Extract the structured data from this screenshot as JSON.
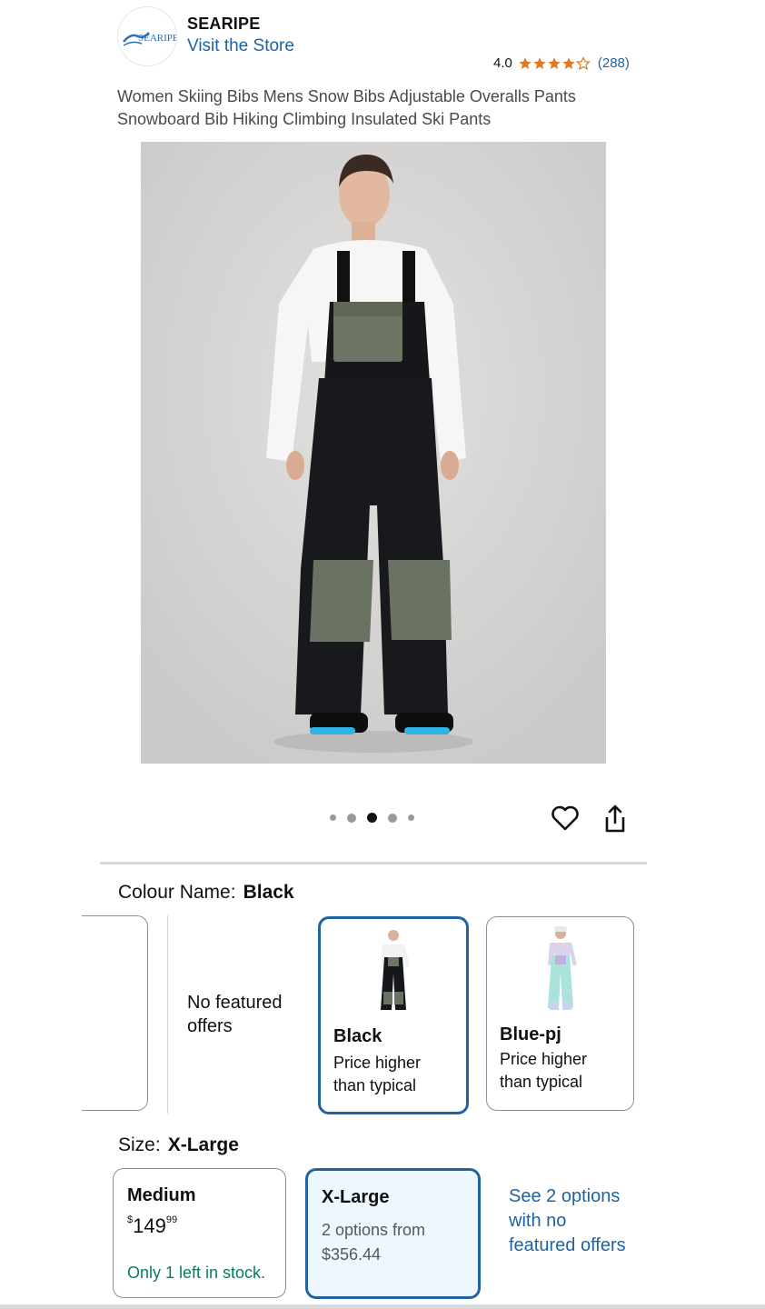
{
  "header": {
    "brand_name": "SEARIPE",
    "logo_text": "SEARIPE",
    "visit_store": "Visit the Store",
    "rating_value": "4.0",
    "rating_stars": 4,
    "review_count": "(288)"
  },
  "product": {
    "title": "Women Skiing Bibs Mens Snow Bibs Adjustable Overalls Pants Snowboard Bib Hiking Climbing Insulated Ski Pants",
    "image_count": 5,
    "active_image_index": 2
  },
  "colour": {
    "label": "Colour Name:",
    "selected": "Black",
    "no_featured": "No featured offers",
    "options": [
      {
        "name": "Black",
        "sub": "Price higher than typical",
        "selected": true
      },
      {
        "name": "Blue-pj",
        "sub": "Price higher than typical",
        "selected": false
      }
    ]
  },
  "size": {
    "label": "Size:",
    "selected": "X-Large",
    "options": [
      {
        "name": "Medium",
        "currency": "$",
        "price_whole": "149",
        "price_fraction": "99",
        "stock": "Only 1 left in stock."
      },
      {
        "name": "X-Large",
        "line1": "2 options from",
        "line2": "$356.44"
      }
    ],
    "see_options": "See 2 options with no featured offers"
  },
  "colors": {
    "link": "#2162a1",
    "star": "#de7921",
    "stock_green": "#067d62",
    "selected_border": "#2162a1"
  }
}
